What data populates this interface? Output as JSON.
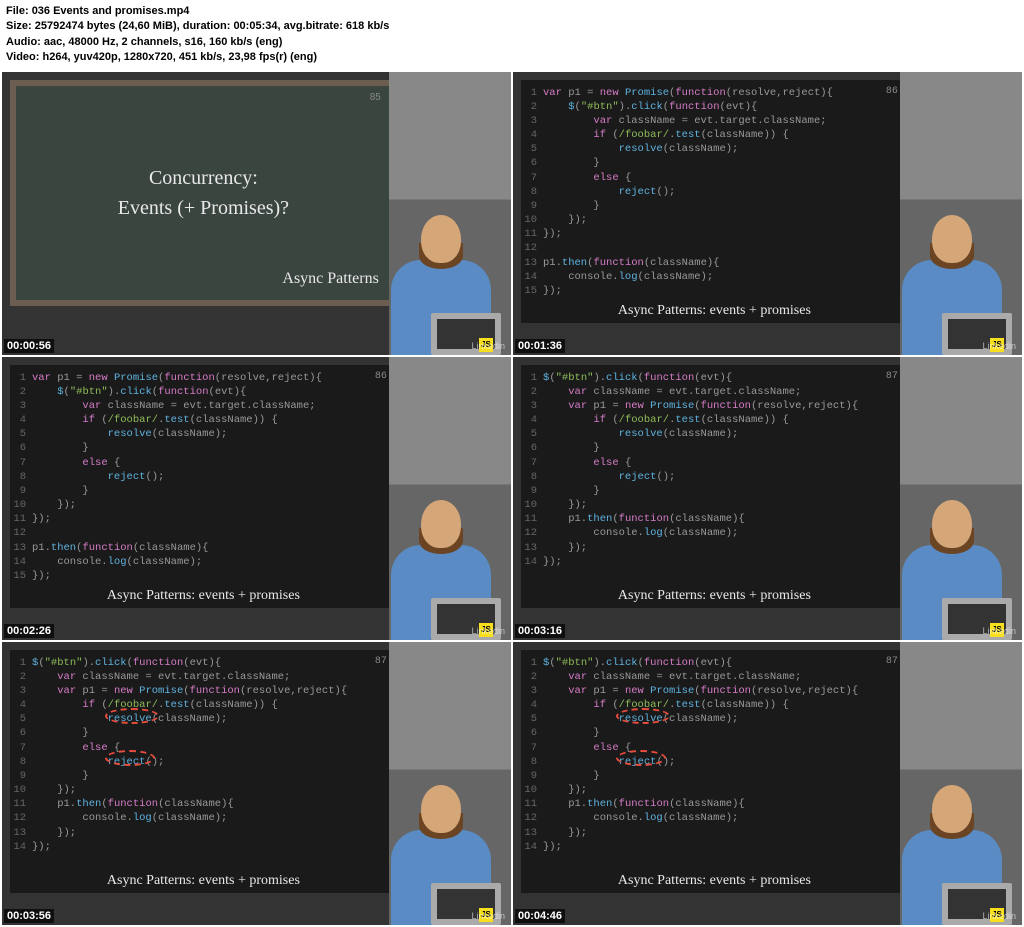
{
  "header": {
    "file_label": "File:",
    "file": "036 Events and promises.mp4",
    "size_label": "Size:",
    "size": "25792474 bytes (24,60 MiB), duration: 00:05:34, avg.bitrate: 618 kb/s",
    "audio_label": "Audio:",
    "audio": "aac, 48000 Hz, 2 channels, s16, 160 kb/s (eng)",
    "video_label": "Video:",
    "video": "h264, yuv420p, 1280x720, 451 kb/s, 23,98 fps(r) (eng)"
  },
  "thumbnails": [
    {
      "timestamp": "00:00:56",
      "slide_num": "85",
      "type": "chalkboard",
      "title_line1": "Concurrency:",
      "title_line2": "Events (+ Promises)?",
      "subtitle": "Async Patterns"
    },
    {
      "timestamp": "00:01:36",
      "slide_num": "86",
      "type": "code",
      "caption": "Async Patterns: events + promises",
      "code_variant": "a"
    },
    {
      "timestamp": "00:02:26",
      "slide_num": "86",
      "type": "code",
      "caption": "Async Patterns: events + promises",
      "code_variant": "a"
    },
    {
      "timestamp": "00:03:16",
      "slide_num": "87",
      "type": "code",
      "caption": "Async Patterns: events + promises",
      "code_variant": "b"
    },
    {
      "timestamp": "00:03:56",
      "slide_num": "87",
      "type": "code",
      "caption": "Async Patterns: events + promises",
      "code_variant": "b",
      "annotated": true
    },
    {
      "timestamp": "00:04:46",
      "slide_num": "87",
      "type": "code",
      "caption": "Async Patterns: events + promises",
      "code_variant": "b",
      "annotated": true
    }
  ],
  "code_a": [
    {
      "n": "1",
      "html": "<span class='kw'>var</span> p1 = <span class='kw'>new</span> <span class='fn'>Promise</span>(<span class='kw'>function</span>(resolve,reject){"
    },
    {
      "n": "2",
      "html": "    <span class='fn'>$</span>(<span class='st'>\"#btn\"</span>).<span class='fn'>click</span>(<span class='kw'>function</span>(evt){"
    },
    {
      "n": "3",
      "html": "        <span class='kw'>var</span> className = evt.target.className;"
    },
    {
      "n": "4",
      "html": "        <span class='kw'>if</span> (<span class='st'>/foobar/</span>.<span class='fn'>test</span>(className)) {"
    },
    {
      "n": "5",
      "html": "            <span class='fn'>resolve</span>(className);"
    },
    {
      "n": "6",
      "html": "        }"
    },
    {
      "n": "7",
      "html": "        <span class='kw'>else</span> {"
    },
    {
      "n": "8",
      "html": "            <span class='fn'>reject</span>();"
    },
    {
      "n": "9",
      "html": "        }"
    },
    {
      "n": "10",
      "html": "    });"
    },
    {
      "n": "11",
      "html": "});"
    },
    {
      "n": "12",
      "html": ""
    },
    {
      "n": "13",
      "html": "p1.<span class='fn'>then</span>(<span class='kw'>function</span>(className){"
    },
    {
      "n": "14",
      "html": "    console.<span class='fn'>log</span>(className);"
    },
    {
      "n": "15",
      "html": "});"
    }
  ],
  "code_b": [
    {
      "n": "1",
      "html": "<span class='fn'>$</span>(<span class='st'>\"#btn\"</span>).<span class='fn'>click</span>(<span class='kw'>function</span>(evt){"
    },
    {
      "n": "2",
      "html": "    <span class='kw'>var</span> className = evt.target.className;"
    },
    {
      "n": "3",
      "html": "    <span class='kw'>var</span> p1 = <span class='kw'>new</span> <span class='fn'>Promise</span>(<span class='kw'>function</span>(resolve,reject){"
    },
    {
      "n": "4",
      "html": "        <span class='kw'>if</span> (<span class='st'>/foobar/</span>.<span class='fn'>test</span>(className)) {"
    },
    {
      "n": "5",
      "html": "            <span class='fn'>resolve</span>(className);"
    },
    {
      "n": "6",
      "html": "        }"
    },
    {
      "n": "7",
      "html": "        <span class='kw'>else</span> {"
    },
    {
      "n": "8",
      "html": "            <span class='fn'>reject</span>();"
    },
    {
      "n": "9",
      "html": "        }"
    },
    {
      "n": "10",
      "html": "    });"
    },
    {
      "n": "11",
      "html": "    p1.<span class='fn'>then</span>(<span class='kw'>function</span>(className){"
    },
    {
      "n": "12",
      "html": "        console.<span class='fn'>log</span>(className);"
    },
    {
      "n": "13",
      "html": "    });"
    },
    {
      "n": "14",
      "html": "});"
    }
  ],
  "watermark": "Linkedin"
}
